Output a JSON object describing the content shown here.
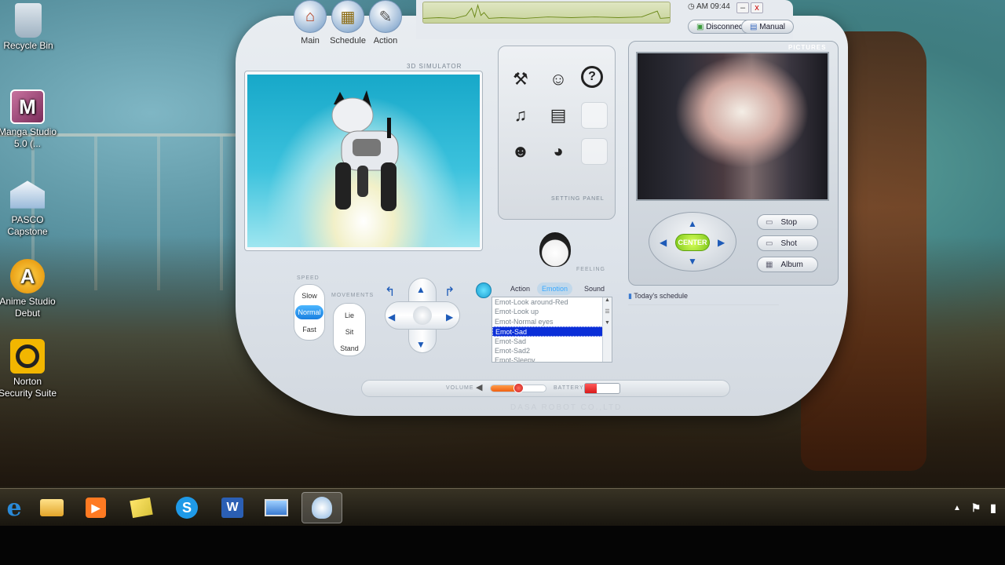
{
  "desktop_icons": [
    {
      "label": "Recycle Bin",
      "icon": "recycle-bin-icon"
    },
    {
      "label": "Manga Studio 5.0 (...",
      "icon": "manga-studio-icon",
      "glyph": "M"
    },
    {
      "label": "PASCO Capstone",
      "icon": "pasco-capstone-icon"
    },
    {
      "label": "Anime Studio Debut",
      "icon": "anime-studio-icon",
      "glyph": "A"
    },
    {
      "label": "Norton Security Suite",
      "icon": "norton-icon"
    }
  ],
  "nav": {
    "main_label": "Main",
    "schedule_label": "Schedule",
    "action_label": "Action"
  },
  "titlebar": {
    "clock": "AM 09:44",
    "disconnect_label": "Disconnect",
    "manual_label": "Manual",
    "minimize_glyph": "–",
    "close_glyph": "x"
  },
  "simulator": {
    "label": "3D SIMULATOR"
  },
  "setting_panel": {
    "label": "SETTING PANEL"
  },
  "feeling": {
    "label": "FEELING"
  },
  "pictures": {
    "label": "PICTURES",
    "center_label": "CENTER",
    "stop_label": "Stop",
    "shot_label": "Shot",
    "album_label": "Album"
  },
  "controls": {
    "speed_label": "SPEED",
    "speed_options": [
      "Slow",
      "Normal",
      "Fast"
    ],
    "speed_selected": "Normal",
    "movements_label": "MOVEMENTS",
    "movement_options": [
      "Lie",
      "Sit",
      "Stand"
    ]
  },
  "tabs": {
    "action": "Action",
    "emotion": "Emotion",
    "sound": "Sound",
    "selected": "Emotion"
  },
  "emotion_list": {
    "items": [
      "Emot-Look around-Red",
      "Emot-Look up",
      "Emot-Normal eyes",
      "Emot-Sad",
      "Emot-Sad",
      "Emot-Sad2",
      "Emot-Sleepy"
    ],
    "selected_index": 3
  },
  "schedule": {
    "label": "Today's schedule"
  },
  "bottom": {
    "volume_label": "VOLUME",
    "volume_level": 0.5,
    "battery_label": "BATTERY",
    "battery_level": 0.35,
    "brand": "DASA ROBOT CO.,LTD"
  },
  "colors": {
    "accent_blue": "#1a7fe0",
    "center_green": "#7cc61a",
    "list_selected": "#0b2fd8"
  }
}
